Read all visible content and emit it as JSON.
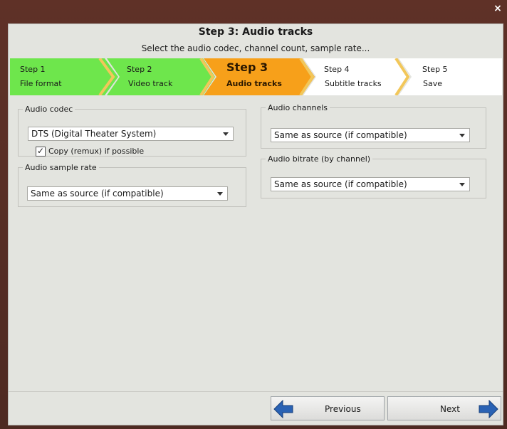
{
  "window": {
    "title": "Step 3: Audio tracks",
    "subtitle": "Select the audio codec, channel count, sample rate..."
  },
  "steps": [
    {
      "title": "Step 1",
      "label": "File format",
      "state": "done"
    },
    {
      "title": "Step 2",
      "label": "Video track",
      "state": "done"
    },
    {
      "title": "Step 3",
      "label": "Audio tracks",
      "state": "current"
    },
    {
      "title": "Step 4",
      "label": "Subtitle tracks",
      "state": "pending"
    },
    {
      "title": "Step 5",
      "label": "Save",
      "state": "pending"
    }
  ],
  "audio_codec": {
    "legend": "Audio codec",
    "value": "DTS (Digital Theater System)",
    "copy_label": "Copy (remux) if possible",
    "copy_checked": true
  },
  "audio_sample_rate": {
    "legend": "Audio sample rate",
    "value": "Same as source (if compatible)"
  },
  "audio_channels": {
    "legend": "Audio channels",
    "value": "Same as source (if compatible)"
  },
  "audio_bitrate": {
    "legend": "Audio bitrate (by channel)",
    "value": "Same as source (if compatible)"
  },
  "buttons": {
    "previous": "Previous",
    "next": "Next",
    "close": "×"
  },
  "colors": {
    "done": "#6ee64c",
    "current": "#f7a01a",
    "pending": "#ffffff",
    "chevron": "#f2c75a",
    "arrow_blue": "#2a62b4"
  }
}
